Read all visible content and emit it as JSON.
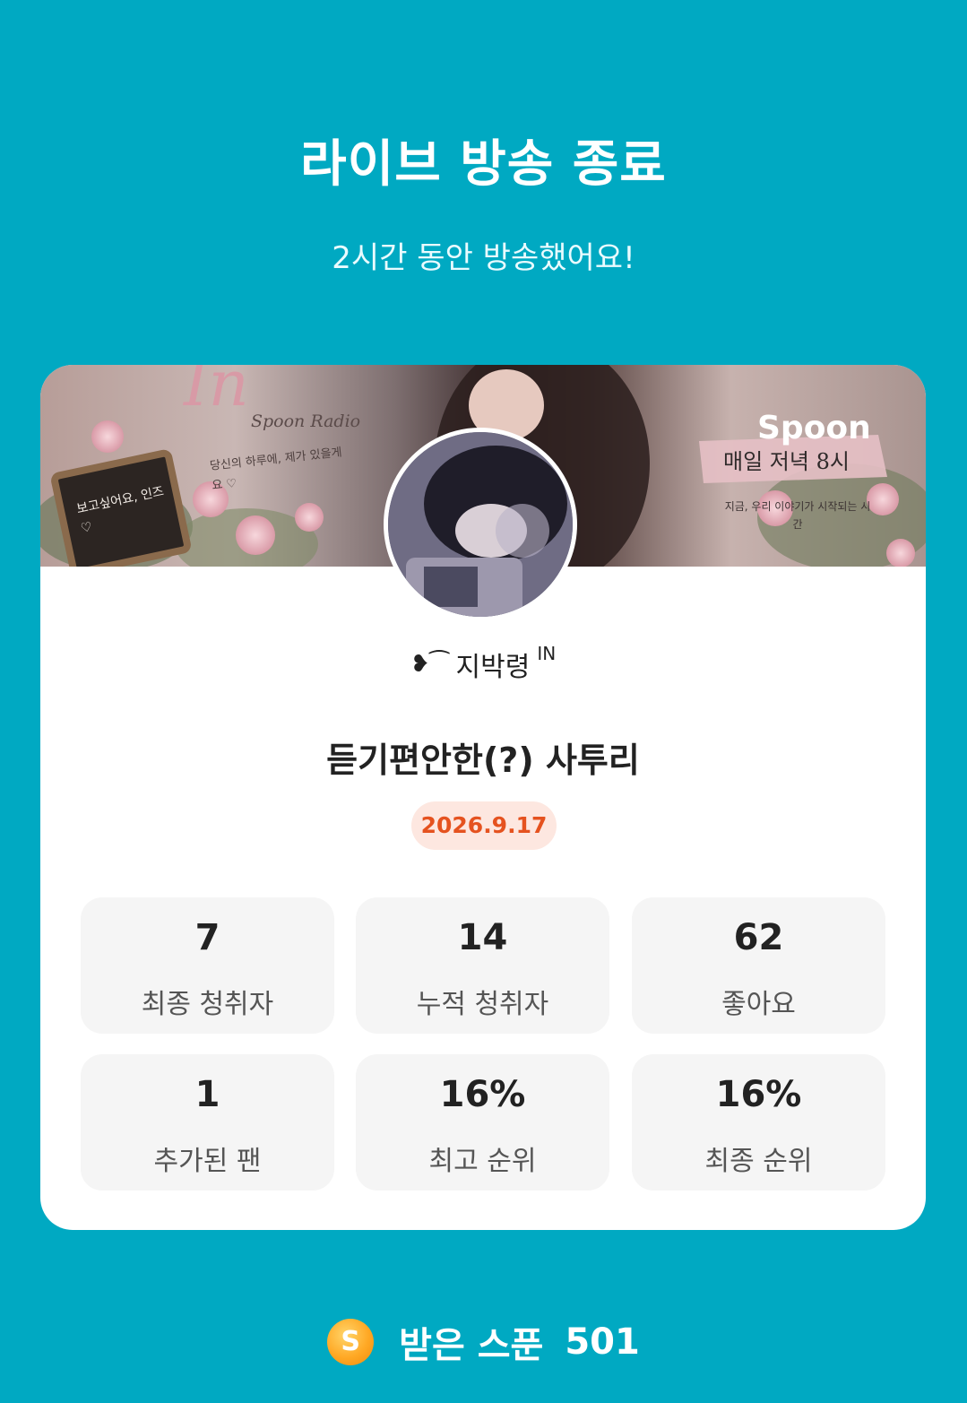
{
  "header": {
    "title": "라이브 방송 종료",
    "subtitle": "2시간 동안 방송했어요!"
  },
  "banner": {
    "script_title": "In",
    "spoon_radio": "Spoon Radio",
    "left_text": "당신의 하루에, 제가 있을게요 ♡",
    "board_text": "보고싶어요, 인즈♡",
    "brand": "Spoon",
    "schedule": "매일 저녁 8시",
    "right_text": "지금, 우리 이야기가 시작되는 시간"
  },
  "profile": {
    "nickname_deco": "❥︎⁀",
    "nickname": "지박령",
    "nickname_sup": "IN"
  },
  "broadcast": {
    "title": "듣기편안한(?) 사투리",
    "date": "2026.9.17"
  },
  "stats": [
    {
      "value": "7",
      "label": "최종 청취자"
    },
    {
      "value": "14",
      "label": "누적 청취자"
    },
    {
      "value": "62",
      "label": "좋아요"
    },
    {
      "value": "1",
      "label": "추가된 팬"
    },
    {
      "value": "16%",
      "label": "최고 순위"
    },
    {
      "value": "16%",
      "label": "최종 순위"
    }
  ],
  "footer": {
    "coin_letter": "S",
    "label": "받은 스푼",
    "value": "501"
  },
  "colors": {
    "background": "#00a9c2",
    "date_badge_bg": "#fde7e0",
    "date_text": "#e5521f",
    "coin": "#ffa824"
  },
  "icons": {
    "coin": "spoon-coin-icon"
  }
}
